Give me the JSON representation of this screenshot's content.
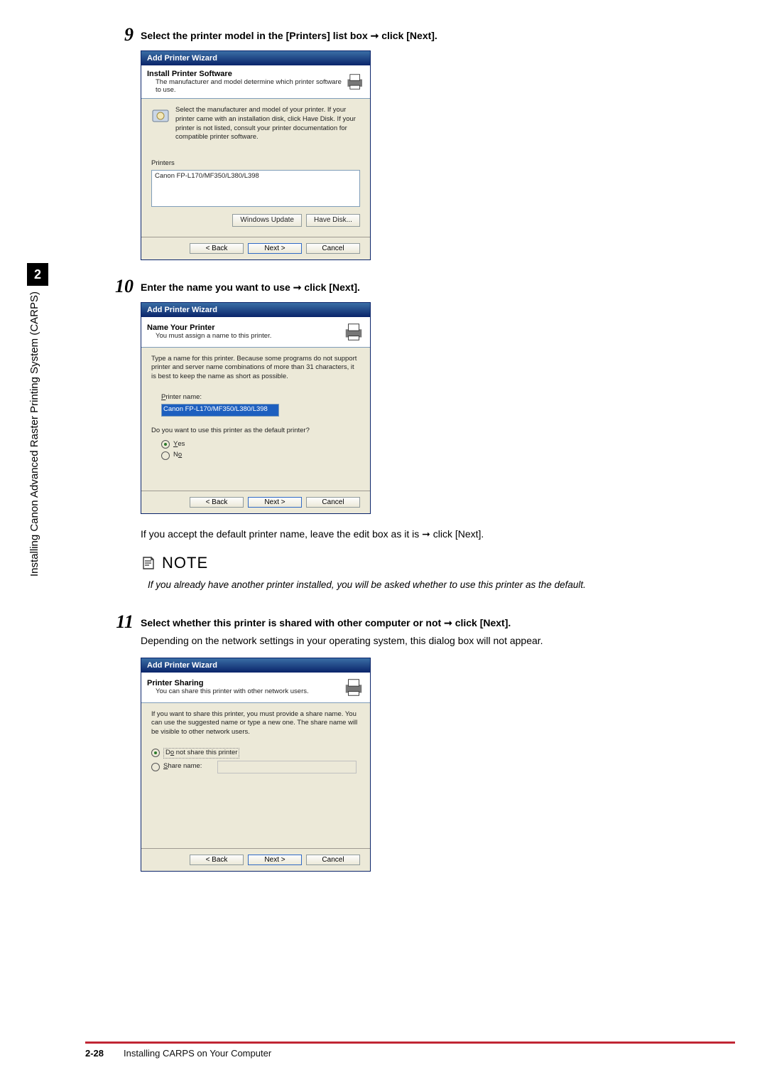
{
  "sidebar": {
    "chapter_number": "2",
    "chapter_title": "Installing Canon Advanced Raster Printing System (CARPS)"
  },
  "steps": {
    "s9": {
      "num": "9",
      "title": "Select the printer model in the [Printers] list box ➞ click [Next].",
      "wizard": {
        "title": "Add Printer Wizard",
        "head_title": "Install Printer Software",
        "head_sub": "The manufacturer and model determine which printer software to use.",
        "body_text": "Select the manufacturer and model of your printer. If your printer came with an installation disk, click Have Disk. If your printer is not listed, consult your printer documentation for compatible printer software.",
        "list_label": "Printers",
        "list_item": "Canon FP-L170/MF350/L380/L398",
        "btn_update": "Windows Update",
        "btn_havedisk": "Have Disk...",
        "btn_back": "< Back",
        "btn_next": "Next >",
        "btn_cancel": "Cancel"
      }
    },
    "s10": {
      "num": "10",
      "title": "Enter the name you want to use ➞ click [Next].",
      "wizard": {
        "title": "Add Printer Wizard",
        "head_title": "Name Your Printer",
        "head_sub": "You must assign a name to this printer.",
        "body_text": "Type a name for this printer. Because some programs do not support printer and server name combinations of more than 31 characters, it is best to keep the name as short as possible.",
        "name_label": "Printer name:",
        "name_value": "Canon FP-L170/MF350/L380/L398",
        "default_q": "Do you want to use this printer as the default printer?",
        "yes_label": "Yes",
        "no_label": "No",
        "btn_back": "< Back",
        "btn_next": "Next >",
        "btn_cancel": "Cancel"
      },
      "after_text": "If you accept the default printer name, leave the edit box as it is ➞ click [Next].",
      "note_label": "NOTE",
      "note_body": "If you already have another printer installed, you will be asked whether to use this printer as the default."
    },
    "s11": {
      "num": "11",
      "title": "Select whether this printer is shared with other computer or not ➞ click [Next].",
      "subtitle": "Depending on the network settings in your operating system, this dialog box will not appear.",
      "wizard": {
        "title": "Add Printer Wizard",
        "head_title": "Printer Sharing",
        "head_sub": "You can share this printer with other network users.",
        "body_text": "If you want to share this printer, you must provide a share name. You can use the suggested name or type a new one. The share name will be visible to other network users.",
        "opt_no_share": "Do not share this printer",
        "opt_share": "Share name:",
        "btn_back": "< Back",
        "btn_next": "Next >",
        "btn_cancel": "Cancel"
      }
    }
  },
  "footer": {
    "page": "2-28",
    "text": "Installing CARPS on Your Computer"
  }
}
